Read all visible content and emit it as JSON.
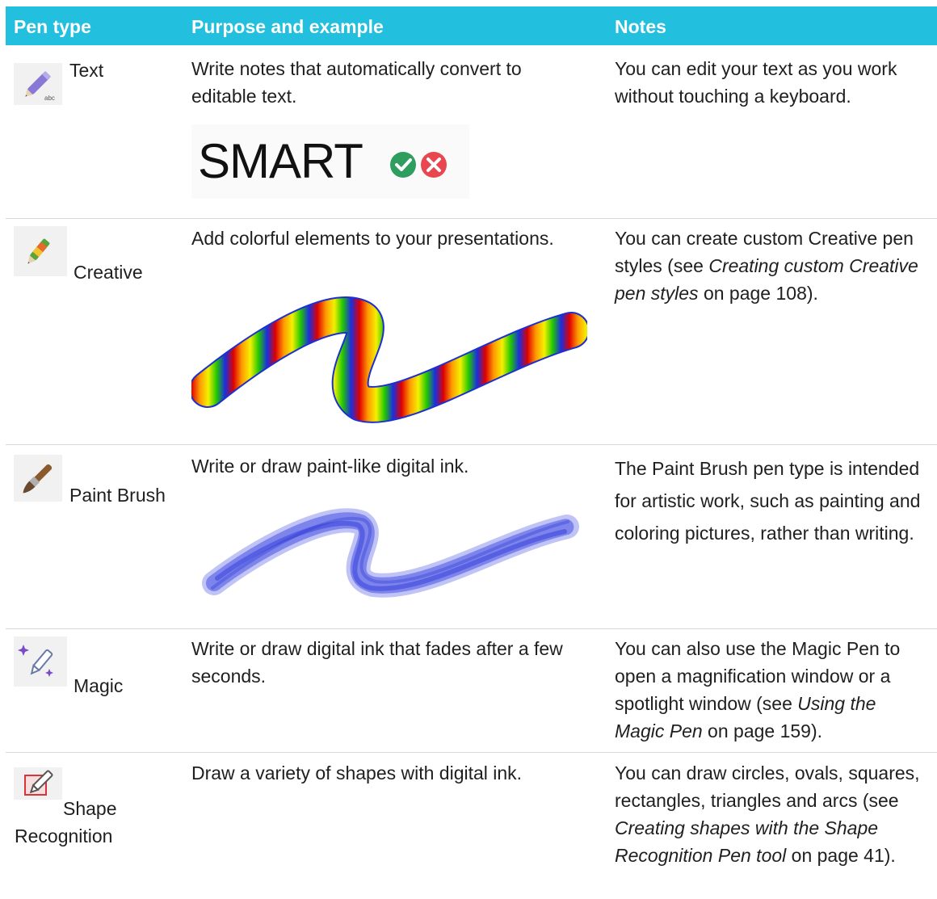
{
  "header": {
    "col1": "Pen type",
    "col2": "Purpose and example",
    "col3": "Notes"
  },
  "rows": [
    {
      "pen": "Text",
      "icon": "text-pen-icon",
      "purpose": "Write notes that automatically convert to editable text.",
      "example_word": "SMART",
      "notes": "You can edit your text as you work without touching a keyboard."
    },
    {
      "pen": "Creative",
      "icon": "creative-pen-icon",
      "purpose": "Add colorful elements to your presentations.",
      "notes_before": "You can create custom Creative pen styles (see ",
      "notes_link": "Creating custom Creative pen styles",
      "notes_after": " on page 108)."
    },
    {
      "pen": "Paint Brush",
      "icon": "paint-brush-icon",
      "purpose": "Write or draw paint-like digital ink.",
      "notes": "The Paint Brush pen type is intended for artistic work, such as painting and coloring pictures, rather than writing."
    },
    {
      "pen": "Magic",
      "icon": "magic-pen-icon",
      "purpose": "Write or draw digital ink that fades after a few seconds.",
      "notes_before": "You can also use the Magic Pen to open a magnification window or a spotlight window (see ",
      "notes_link": "Using the Magic Pen",
      "notes_after": " on page 159)."
    },
    {
      "pen": "Shape Recognition",
      "icon": "shape-recognition-pen-icon",
      "purpose": "Draw a variety of shapes with digital ink.",
      "notes_before": "You can draw circles, ovals, squares, rectangles, triangles and arcs (see ",
      "notes_link": "Creating shapes with the Shape Recognition Pen tool",
      "notes_after": " on page 41)."
    }
  ],
  "colors": {
    "header_bg": "#22bfdf",
    "header_text": "#ffffff",
    "row_divider": "#d9d9d9"
  }
}
